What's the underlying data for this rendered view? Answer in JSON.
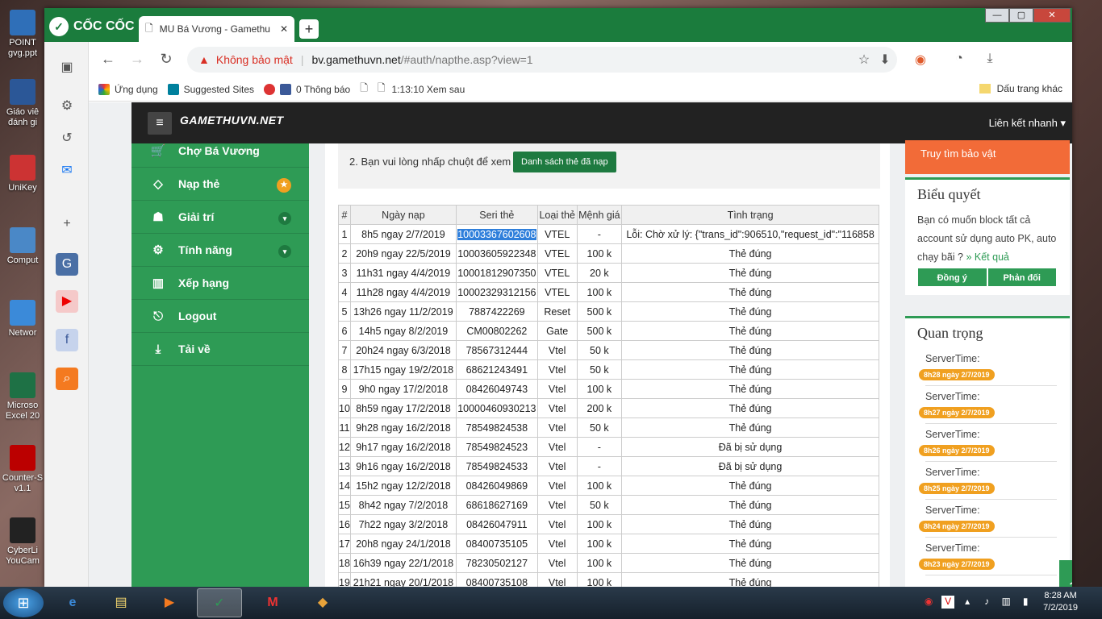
{
  "desktop": {
    "icons": [
      {
        "label": "POINT gvg.ppt",
        "color": "#2f6fb8"
      },
      {
        "label": "Giáo viê đánh gi",
        "color": "#2b5797"
      },
      {
        "label": "UniKey",
        "color": "#c33"
      },
      {
        "label": "Comput",
        "color": "#4a88c7"
      },
      {
        "label": "Networ",
        "color": "#3b8ad9"
      },
      {
        "label": "Microso Excel 20",
        "color": "#1e7145"
      },
      {
        "label": "Counter-S v1.1",
        "color": "#b00"
      },
      {
        "label": "CyberLi YouCam",
        "color": "#222"
      }
    ]
  },
  "browser": {
    "brand": "CỐC CỐC",
    "tab_title": "MU Bá Vương - Gamethu",
    "new_tab": "+",
    "window_buttons": [
      "—",
      "▢",
      "✕"
    ],
    "address": {
      "security": "Không bảo mật",
      "host": "bv.gamethuvn.net",
      "path": "/#auth/napthe.asp?view=1"
    },
    "bookmarks": [
      "Ứng dụng",
      "Suggested Sites",
      "0 Thông báo",
      "",
      "1:13:10 Xem sau"
    ],
    "bookmarks_other": "Dấu trang khác"
  },
  "site": {
    "logo": "GAMETHUVN.NET",
    "quick_links": "Liên kết nhanh ▾",
    "menu": [
      {
        "label": "Chợ Bá Vương",
        "icon": "🛒"
      },
      {
        "label": "Nạp thẻ",
        "icon": "◇"
      },
      {
        "label": "Giải trí",
        "icon": "☗"
      },
      {
        "label": "Tính năng",
        "icon": "⚙"
      },
      {
        "label": "Xếp hạng",
        "icon": "▥"
      },
      {
        "label": "Logout",
        "icon": "⎋"
      },
      {
        "label": "Tải về",
        "icon": "⤓"
      }
    ],
    "note_text": "2. Bạn vui lòng nhấp chuột để xem",
    "note_button": "Danh sách thẻ đã nạp",
    "table_headers": [
      "#",
      "Ngày nạp",
      "Seri thẻ",
      "Loại thẻ",
      "Mệnh giá",
      "Tình trạng"
    ],
    "rows": [
      [
        "1",
        "8h5 ngay 2/7/2019",
        "10003367602608",
        "VTEL",
        "-",
        "Lỗi: Chờ xử lý: {\"trans_id\":906510,\"request_id\":\"116858"
      ],
      [
        "2",
        "20h9 ngay 22/5/2019",
        "10003605922348",
        "VTEL",
        "100 k",
        "Thẻ đúng"
      ],
      [
        "3",
        "11h31 ngay 4/4/2019",
        "10001812907350",
        "VTEL",
        "20 k",
        "Thẻ đúng"
      ],
      [
        "4",
        "11h28 ngay 4/4/2019",
        "10002329312156",
        "VTEL",
        "100 k",
        "Thẻ đúng"
      ],
      [
        "5",
        "13h26 ngay 11/2/2019",
        "7887422269",
        "Reset",
        "500 k",
        "Thẻ đúng"
      ],
      [
        "6",
        "14h5 ngay 8/2/2019",
        "CM00802262",
        "Gate",
        "500 k",
        "Thẻ đúng"
      ],
      [
        "7",
        "20h24 ngay 6/3/2018",
        "78567312444",
        "Vtel",
        "50 k",
        "Thẻ đúng"
      ],
      [
        "8",
        "17h15 ngay 19/2/2018",
        "68621243491",
        "Vtel",
        "50 k",
        "Thẻ đúng"
      ],
      [
        "9",
        "9h0 ngay 17/2/2018",
        "08426049743",
        "Vtel",
        "100 k",
        "Thẻ đúng"
      ],
      [
        "10",
        "8h59 ngay 17/2/2018",
        "10000460930213",
        "Vtel",
        "200 k",
        "Thẻ đúng"
      ],
      [
        "11",
        "9h28 ngay 16/2/2018",
        "78549824538",
        "Vtel",
        "50 k",
        "Thẻ đúng"
      ],
      [
        "12",
        "9h17 ngay 16/2/2018",
        "78549824523",
        "Vtel",
        "-",
        "Đã bị sử dụng"
      ],
      [
        "13",
        "9h16 ngay 16/2/2018",
        "78549824533",
        "Vtel",
        "-",
        "Đã bị sử dụng"
      ],
      [
        "14",
        "15h2 ngay 12/2/2018",
        "08426049869",
        "Vtel",
        "100 k",
        "Thẻ đúng"
      ],
      [
        "15",
        "8h42 ngay 7/2/2018",
        "68618627169",
        "Vtel",
        "50 k",
        "Thẻ đúng"
      ],
      [
        "16",
        "7h22 ngay 3/2/2018",
        "08426047911",
        "Vtel",
        "100 k",
        "Thẻ đúng"
      ],
      [
        "17",
        "20h8 ngay 24/1/2018",
        "08400735105",
        "Vtel",
        "100 k",
        "Thẻ đúng"
      ],
      [
        "18",
        "16h39 ngay 22/1/2018",
        "78230502127",
        "Vtel",
        "100 k",
        "Thẻ đúng"
      ],
      [
        "19",
        "21h21 ngay 20/1/2018",
        "08400735108",
        "Vtel",
        "100 k",
        "Thẻ đúng"
      ]
    ],
    "right": {
      "orange_link": "Truy tìm bảo vật",
      "poll_title": "Biểu quyết",
      "poll_question": "Bạn có muốn block tất cả account sử dụng auto PK, auto chạy bãi ?",
      "poll_result": "» Kết quả",
      "poll_yes": "Đồng ý",
      "poll_no": "Phản đối",
      "important_title": "Quan trọng",
      "server_label": "ServerTime:",
      "server_times": [
        "8h28 ngày 2/7/2019",
        "8h27 ngày 2/7/2019",
        "8h26 ngày 2/7/2019",
        "8h25 ngày 2/7/2019",
        "8h24 ngày 2/7/2019",
        "8h23 ngày 2/7/2019"
      ]
    }
  },
  "taskbar": {
    "time": "8:28 AM",
    "date": "7/2/2019"
  }
}
